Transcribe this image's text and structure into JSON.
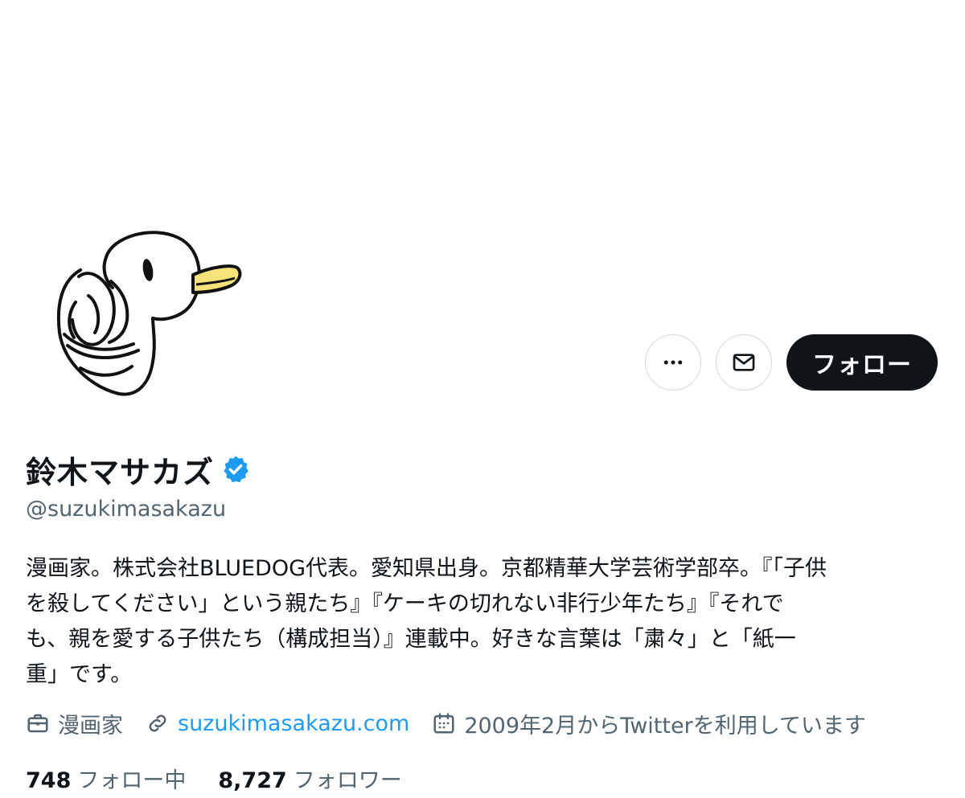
{
  "profile": {
    "display_name": "鈴木マサカズ",
    "handle": "@suzukimasakazu",
    "bio_lines": [
      "漫画家。株式会社BLUEDOG代表。愛知県出身。京都精華大学芸術学部卒。『「子供",
      "を殺してください」という親たち』『ケーキの切れない非行少年たち』『それで",
      "も、親を愛する子供たち（構成担当）』連載中。好きな言葉は「粛々」と「紙一",
      "重」です。"
    ],
    "profession": "漫画家",
    "website": "suzukimasakazu.com",
    "joined": "2009年2月からTwitterを利用しています",
    "following_count": "748",
    "following_label": "フォロー中",
    "followers_count": "8,727",
    "followers_label": "フォロワー"
  },
  "actions": {
    "follow_label": "フォロー",
    "more_icon": "more-icon",
    "message_icon": "mail-icon"
  },
  "colors": {
    "accent": "#1d9bf0",
    "text_primary": "#0f1419",
    "text_secondary": "#536471",
    "button_dark": "#0f1419",
    "border": "#cfd9de"
  }
}
